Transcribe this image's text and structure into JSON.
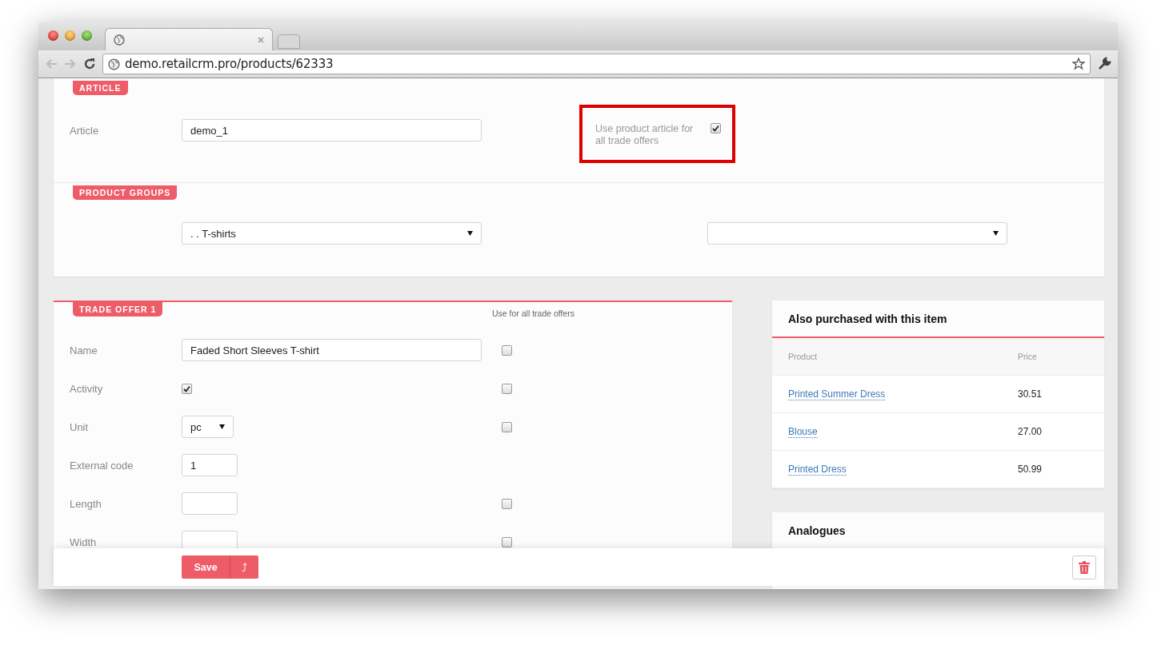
{
  "browser": {
    "address": "demo.retailcrm.pro/products/62333"
  },
  "article_section": {
    "badge": "ARTICLE",
    "label": "Article",
    "value": "demo_1",
    "option": {
      "label": "Use product article for all trade offers",
      "checked": true,
      "highlighted": true
    }
  },
  "product_groups": {
    "badge": "PRODUCT GROUPS",
    "group_select": {
      "value": ". . T-shirts"
    }
  },
  "trade_offer": {
    "badge": "TRADE OFFER 1",
    "column_header": "Use for all trade offers",
    "rows": [
      {
        "kind": "text",
        "label": "Name",
        "value": "Faded Short Sleeves T-shirt",
        "use_for_all": false
      },
      {
        "kind": "checkbox",
        "label": "Activity",
        "checked": true,
        "use_for_all": false
      },
      {
        "kind": "select",
        "label": "Unit",
        "value": "pc",
        "use_for_all": false
      },
      {
        "kind": "short",
        "label": "External code",
        "value": "1"
      },
      {
        "kind": "short",
        "label": "Length",
        "use_for_all": false
      },
      {
        "kind": "short",
        "label": "Width",
        "use_for_all": false
      }
    ]
  },
  "also_purchased": {
    "title": "Also purchased with this item",
    "columns": [
      "Product",
      "Price"
    ],
    "rows": [
      {
        "product": "Printed Summer Dress",
        "price": "30.51"
      },
      {
        "product": "Blouse",
        "price": "27.00"
      },
      {
        "product": "Printed Dress",
        "price": "50.99"
      }
    ]
  },
  "analogues": {
    "title": "Analogues"
  },
  "footer": {
    "save": "Save",
    "extra": "⤴"
  }
}
